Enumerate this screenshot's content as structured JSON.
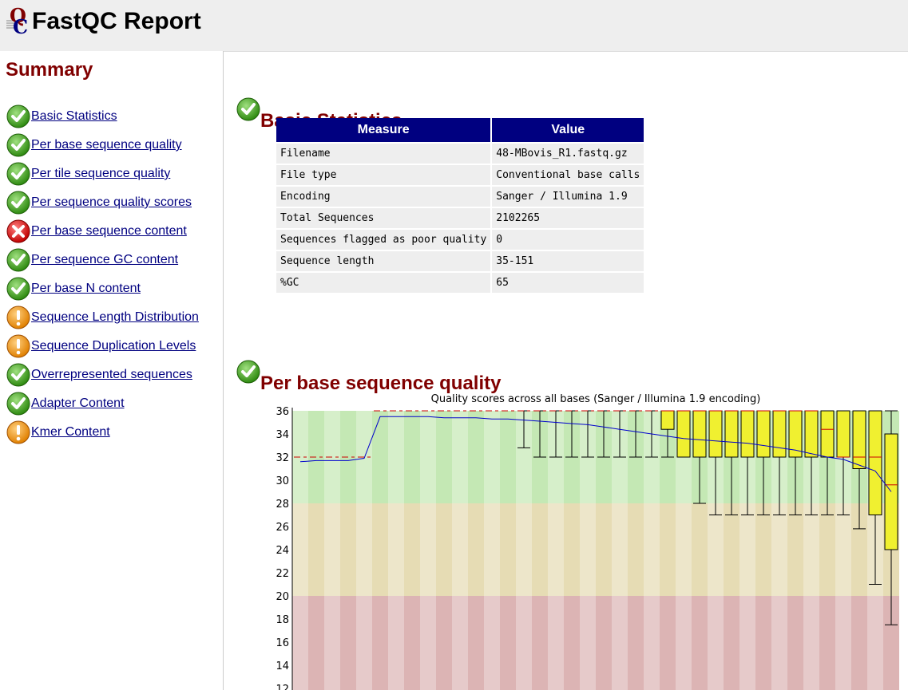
{
  "header": {
    "title": "FastQC Report",
    "logo_icon": "fastqc-logo-icon"
  },
  "sidebar": {
    "heading": "Summary",
    "items": [
      {
        "label": "Basic Statistics",
        "status": "pass"
      },
      {
        "label": "Per base sequence quality",
        "status": "pass"
      },
      {
        "label": "Per tile sequence quality",
        "status": "pass"
      },
      {
        "label": "Per sequence quality scores",
        "status": "pass"
      },
      {
        "label": "Per base sequence content",
        "status": "fail"
      },
      {
        "label": "Per sequence GC content",
        "status": "pass"
      },
      {
        "label": "Per base N content",
        "status": "pass"
      },
      {
        "label": "Sequence Length Distribution",
        "status": "warn"
      },
      {
        "label": "Sequence Duplication Levels",
        "status": "warn"
      },
      {
        "label": "Overrepresented sequences",
        "status": "pass"
      },
      {
        "label": "Adapter Content",
        "status": "pass"
      },
      {
        "label": "Kmer Content",
        "status": "warn"
      }
    ]
  },
  "basic_stats": {
    "title": "Basic Statistics",
    "status": "pass",
    "columns": [
      "Measure",
      "Value"
    ],
    "rows": [
      [
        "Filename",
        "48-MBovis_R1.fastq.gz"
      ],
      [
        "File type",
        "Conventional base calls"
      ],
      [
        "Encoding",
        "Sanger / Illumina 1.9"
      ],
      [
        "Total Sequences",
        "2102265"
      ],
      [
        "Sequences flagged as poor quality",
        "0"
      ],
      [
        "Sequence length",
        "35-151"
      ],
      [
        "%GC",
        "65"
      ]
    ]
  },
  "quality_section": {
    "title": "Per base sequence quality",
    "status": "pass"
  },
  "colors": {
    "header_bg": "#eeeeee",
    "section_title": "#800000",
    "link": "#000080",
    "table_header": "#000080",
    "table_cell": "#eeeeee",
    "zone_good": "#c4e8b4",
    "zone_ok": "#e6dcb4",
    "zone_bad": "#dcb4b4",
    "box": "#f0f030",
    "mean_line": "#0000cc",
    "median": "#cc0000"
  },
  "chart_data": {
    "type": "boxplot",
    "title": "Quality scores across all bases (Sanger / Illumina 1.9 encoding)",
    "xlabel": "",
    "ylabel": "",
    "ylim": [
      12,
      36
    ],
    "yticks": [
      12,
      14,
      16,
      18,
      20,
      22,
      24,
      26,
      28,
      30,
      32,
      34,
      36
    ],
    "zones": [
      {
        "name": "good",
        "from": 28,
        "to": 36
      },
      {
        "name": "reasonable",
        "from": 20,
        "to": 28
      },
      {
        "name": "poor",
        "from": 0,
        "to": 20
      }
    ],
    "positions": [
      {
        "median": 32,
        "q1": 32,
        "q3": 32,
        "lower": 32,
        "upper": 32,
        "mean": 31.6
      },
      {
        "median": 32,
        "q1": 32,
        "q3": 32,
        "lower": 32,
        "upper": 32,
        "mean": 31.7
      },
      {
        "median": 32,
        "q1": 32,
        "q3": 32,
        "lower": 32,
        "upper": 32,
        "mean": 31.7
      },
      {
        "median": 32,
        "q1": 32,
        "q3": 32,
        "lower": 32,
        "upper": 32,
        "mean": 31.7
      },
      {
        "median": 32,
        "q1": 32,
        "q3": 32,
        "lower": 32,
        "upper": 32,
        "mean": 31.9
      },
      {
        "median": 36,
        "q1": 36,
        "q3": 36,
        "lower": 36,
        "upper": 36,
        "mean": 35.5
      },
      {
        "median": 36,
        "q1": 36,
        "q3": 36,
        "lower": 36,
        "upper": 36,
        "mean": 35.5
      },
      {
        "median": 36,
        "q1": 36,
        "q3": 36,
        "lower": 36,
        "upper": 36,
        "mean": 35.5
      },
      {
        "median": 36,
        "q1": 36,
        "q3": 36,
        "lower": 36,
        "upper": 36,
        "mean": 35.5
      },
      {
        "median": 36,
        "q1": 36,
        "q3": 36,
        "lower": 36,
        "upper": 36,
        "mean": 35.4
      },
      {
        "median": 36,
        "q1": 36,
        "q3": 36,
        "lower": 36,
        "upper": 36,
        "mean": 35.4
      },
      {
        "median": 36,
        "q1": 36,
        "q3": 36,
        "lower": 36,
        "upper": 36,
        "mean": 35.4
      },
      {
        "median": 36,
        "q1": 36,
        "q3": 36,
        "lower": 36,
        "upper": 36,
        "mean": 35.3
      },
      {
        "median": 36,
        "q1": 36,
        "q3": 36,
        "lower": 36,
        "upper": 36,
        "mean": 35.3
      },
      {
        "median": 36,
        "q1": 36,
        "q3": 36,
        "lower": 32.8,
        "upper": 36,
        "mean": 35.2
      },
      {
        "median": 36,
        "q1": 36,
        "q3": 36,
        "lower": 32,
        "upper": 36,
        "mean": 35.1
      },
      {
        "median": 36,
        "q1": 36,
        "q3": 36,
        "lower": 32,
        "upper": 36,
        "mean": 35.0
      },
      {
        "median": 36,
        "q1": 36,
        "q3": 36,
        "lower": 32,
        "upper": 36,
        "mean": 34.9
      },
      {
        "median": 36,
        "q1": 36,
        "q3": 36,
        "lower": 32,
        "upper": 36,
        "mean": 34.8
      },
      {
        "median": 36,
        "q1": 36,
        "q3": 36,
        "lower": 32,
        "upper": 36,
        "mean": 34.6
      },
      {
        "median": 36,
        "q1": 36,
        "q3": 36,
        "lower": 32,
        "upper": 36,
        "mean": 34.4
      },
      {
        "median": 36,
        "q1": 36,
        "q3": 36,
        "lower": 32,
        "upper": 36,
        "mean": 34.2
      },
      {
        "median": 36,
        "q1": 36,
        "q3": 36,
        "lower": 32,
        "upper": 36,
        "mean": 34.0
      },
      {
        "median": 36,
        "q1": 34.4,
        "q3": 36,
        "lower": 32,
        "upper": 36,
        "mean": 33.8
      },
      {
        "median": 36,
        "q1": 32,
        "q3": 36,
        "lower": 32,
        "upper": 36,
        "mean": 33.6
      },
      {
        "median": 36,
        "q1": 32,
        "q3": 36,
        "lower": 28,
        "upper": 36,
        "mean": 33.5
      },
      {
        "median": 36,
        "q1": 32,
        "q3": 36,
        "lower": 27,
        "upper": 36,
        "mean": 33.4
      },
      {
        "median": 36,
        "q1": 32,
        "q3": 36,
        "lower": 27,
        "upper": 36,
        "mean": 33.3
      },
      {
        "median": 36,
        "q1": 32,
        "q3": 36,
        "lower": 27,
        "upper": 36,
        "mean": 33.2
      },
      {
        "median": 36,
        "q1": 32,
        "q3": 36,
        "lower": 27,
        "upper": 36,
        "mean": 33.0
      },
      {
        "median": 36,
        "q1": 32,
        "q3": 36,
        "lower": 27,
        "upper": 36,
        "mean": 32.8
      },
      {
        "median": 36,
        "q1": 32,
        "q3": 36,
        "lower": 27,
        "upper": 36,
        "mean": 32.6
      },
      {
        "median": 36,
        "q1": 32,
        "q3": 36,
        "lower": 27,
        "upper": 36,
        "mean": 32.3
      },
      {
        "median": 34.4,
        "q1": 32,
        "q3": 36,
        "lower": 27,
        "upper": 36,
        "mean": 32.0
      },
      {
        "median": 32,
        "q1": 32,
        "q3": 36,
        "lower": 27,
        "upper": 36,
        "mean": 31.8
      },
      {
        "median": 32,
        "q1": 31,
        "q3": 36,
        "lower": 25.8,
        "upper": 36,
        "mean": 31.3
      },
      {
        "median": 32,
        "q1": 27,
        "q3": 36,
        "lower": 21,
        "upper": 36,
        "mean": 30.8
      },
      {
        "median": 29.6,
        "q1": 24,
        "q3": 34,
        "lower": 17.5,
        "upper": 36,
        "mean": 29.0
      }
    ]
  }
}
